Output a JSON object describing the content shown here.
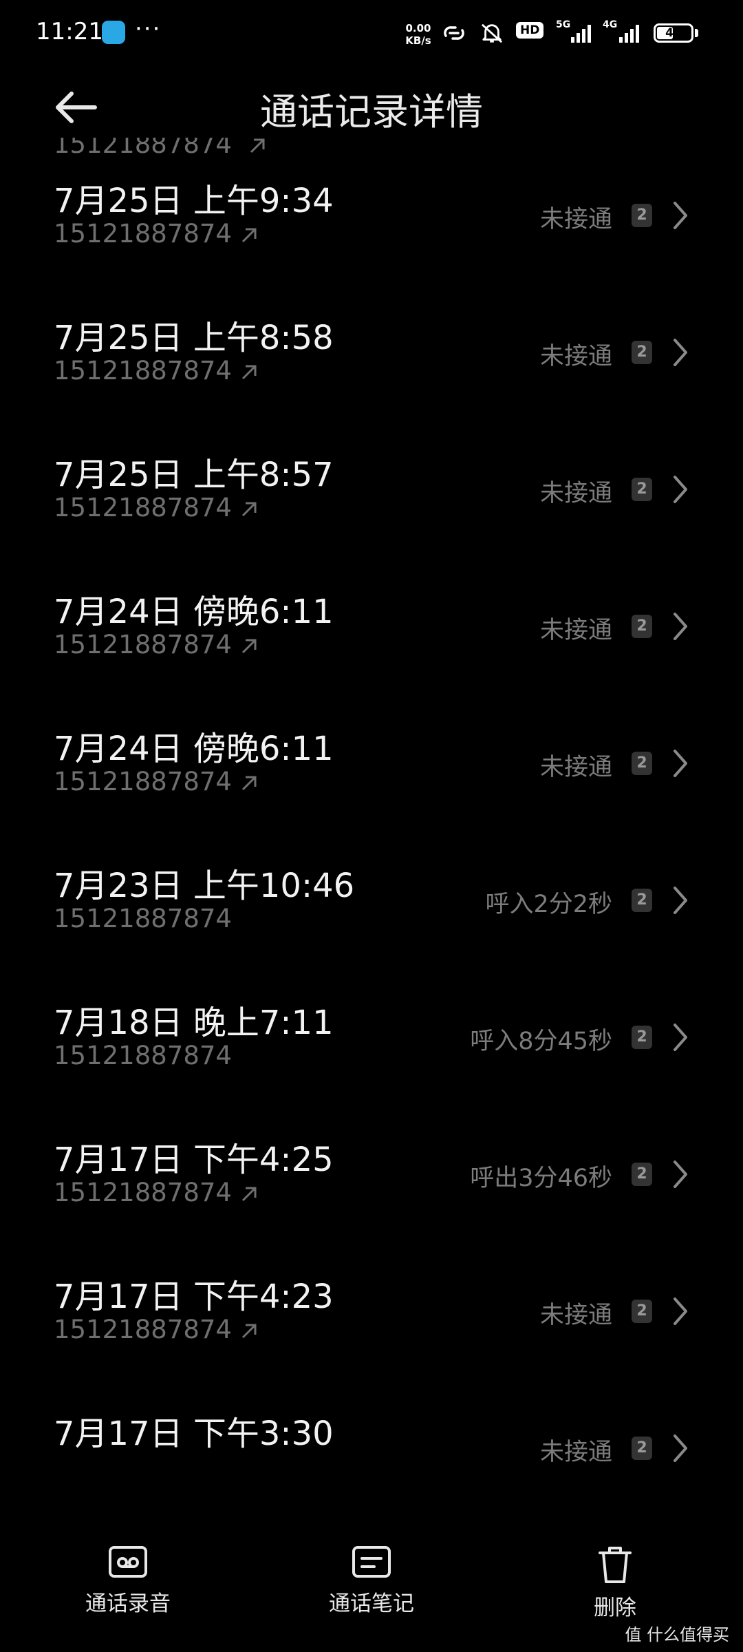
{
  "status_bar": {
    "time": "11:21",
    "dots": "···",
    "net_speed_value": "0.00",
    "net_speed_unit": "KB/s",
    "hd_label": "HD",
    "net1": "5G",
    "net2": "4G",
    "battery": "44"
  },
  "header": {
    "title": "通话记录详情"
  },
  "partial_top_number": "15121887874",
  "calls": [
    {
      "datetime": "7月25日 上午9:34",
      "number": "15121887874",
      "status": "未接通",
      "sim": "2",
      "outgoing": true
    },
    {
      "datetime": "7月25日 上午8:58",
      "number": "15121887874",
      "status": "未接通",
      "sim": "2",
      "outgoing": true
    },
    {
      "datetime": "7月25日 上午8:57",
      "number": "15121887874",
      "status": "未接通",
      "sim": "2",
      "outgoing": true
    },
    {
      "datetime": "7月24日 傍晚6:11",
      "number": "15121887874",
      "status": "未接通",
      "sim": "2",
      "outgoing": true
    },
    {
      "datetime": "7月24日 傍晚6:11",
      "number": "15121887874",
      "status": "未接通",
      "sim": "2",
      "outgoing": true
    },
    {
      "datetime": "7月23日 上午10:46",
      "number": "15121887874",
      "status": "呼入2分2秒",
      "sim": "2",
      "outgoing": false
    },
    {
      "datetime": "7月18日 晚上7:11",
      "number": "15121887874",
      "status": "呼入8分45秒",
      "sim": "2",
      "outgoing": false
    },
    {
      "datetime": "7月17日 下午4:25",
      "number": "15121887874",
      "status": "呼出3分46秒",
      "sim": "2",
      "outgoing": true
    },
    {
      "datetime": "7月17日 下午4:23",
      "number": "15121887874",
      "status": "未接通",
      "sim": "2",
      "outgoing": true
    },
    {
      "datetime": "7月17日 下午3:30",
      "number": "",
      "status": "未接通",
      "sim": "2",
      "outgoing": true
    }
  ],
  "bottom_bar": {
    "recording": "通话录音",
    "notes": "通话笔记",
    "delete": "删除"
  },
  "watermark": "值 什么值得买"
}
